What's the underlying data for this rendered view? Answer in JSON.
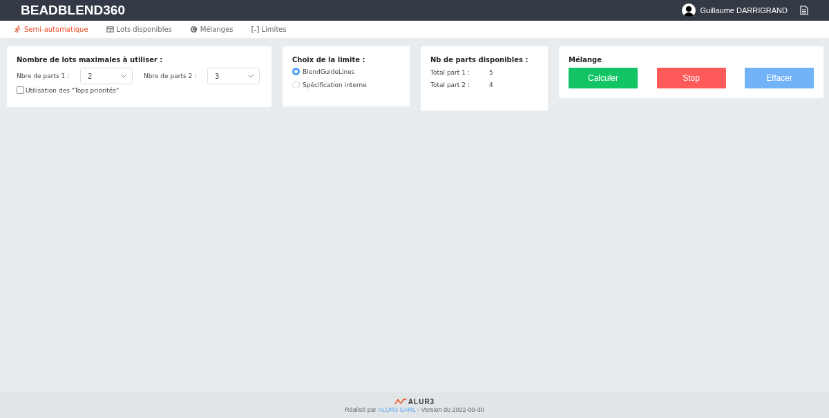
{
  "header": {
    "title": "BEADBLEND360",
    "user": "Guillaume DARRIGRAND"
  },
  "tabs": [
    {
      "label": "Semi-automatique",
      "kind": "run",
      "selected": true
    },
    {
      "label": "Lots disponibles",
      "kind": "table",
      "selected": false
    },
    {
      "label": "Mélanges",
      "kind": "blend",
      "selected": false
    },
    {
      "label": "Limites",
      "kind": "bracket",
      "selected": false
    }
  ],
  "lots_card": {
    "title": "Nombre de lots maximales à utiliser :",
    "fields": [
      {
        "label": "Nbre de parts 1 :",
        "value": "2"
      },
      {
        "label": "Nbre de parts 2 :",
        "value": "3"
      }
    ],
    "checkbox": {
      "label": "Utilisation des \"Tops priorités\"",
      "checked": false
    }
  },
  "limit_card": {
    "title": "Choix de la limite :",
    "options": [
      {
        "label": "BlendGuideLines",
        "selected": true
      },
      {
        "label": "Spécification interne",
        "selected": false
      }
    ]
  },
  "parts_card": {
    "title": "Nb de parts disponibles :",
    "rows": [
      {
        "label": "Total part 1 :",
        "value": "5"
      },
      {
        "label": "Total part 2 :",
        "value": "4"
      }
    ]
  },
  "blend_card": {
    "title": "Mélange",
    "buttons": [
      {
        "label": "Calculer",
        "kind": "success"
      },
      {
        "label": "Stop",
        "kind": "danger"
      },
      {
        "label": "Effacer",
        "kind": "info"
      }
    ]
  },
  "footer": {
    "logo": "ALUR3",
    "prefix": "Réalisé par ",
    "link": "ALUR3 SARL",
    "suffix": " - Version du 2022-09-30"
  }
}
